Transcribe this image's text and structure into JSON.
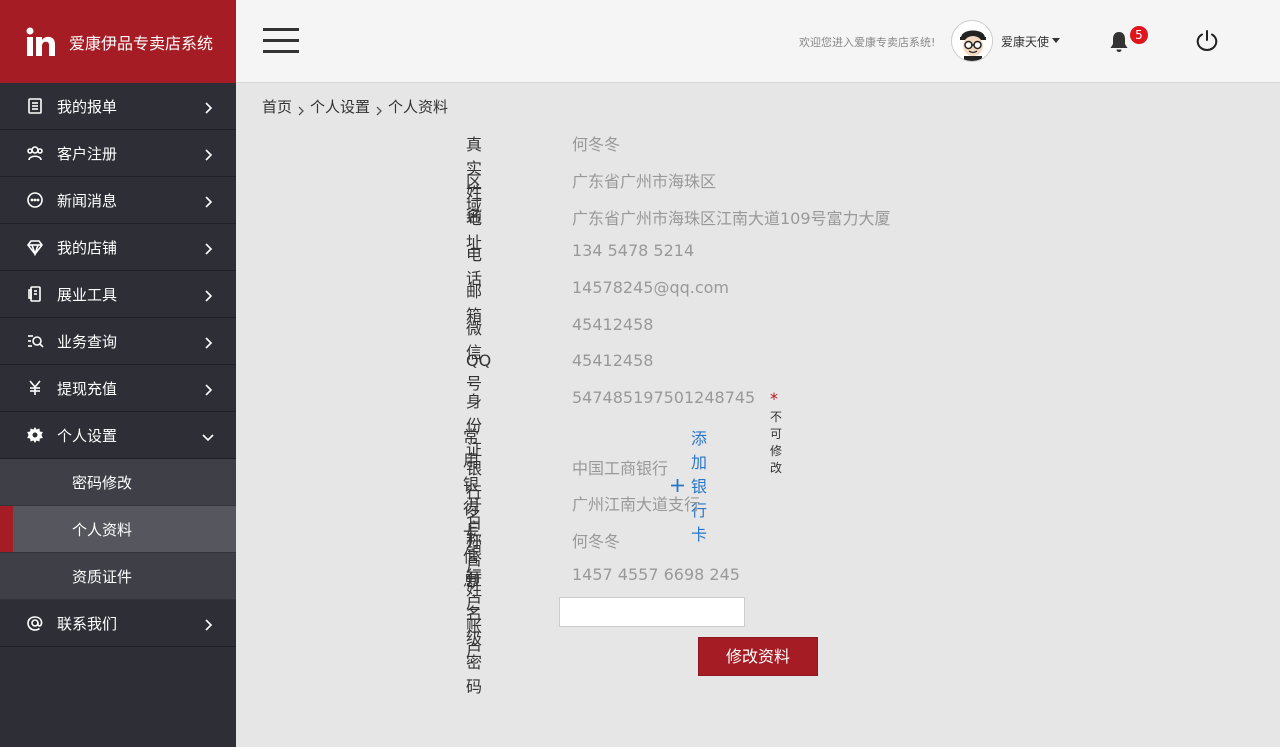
{
  "brand": {
    "name": "爱康伊品专卖店系统",
    "logo_text": "in"
  },
  "colors": {
    "brand_red": "#a61c24",
    "sidebar_bg": "#2e2f36",
    "link_blue": "#2a77c9",
    "badge_red": "#e0141d"
  },
  "sidebar": {
    "items": [
      {
        "label": "我的报单",
        "icon": "list-doc-icon"
      },
      {
        "label": "客户注册",
        "icon": "users-icon"
      },
      {
        "label": "新闻消息",
        "icon": "chat-bubble-icon"
      },
      {
        "label": "我的店铺",
        "icon": "diamond-icon"
      },
      {
        "label": "展业工具",
        "icon": "tools-icon"
      },
      {
        "label": "业务查询",
        "icon": "search-list-icon"
      },
      {
        "label": "提现充值",
        "icon": "yuan-icon"
      },
      {
        "label": "个人设置",
        "icon": "gear-icon"
      },
      {
        "label": "联系我们",
        "icon": "at-icon"
      }
    ],
    "sub_items": [
      {
        "label": "密码修改"
      },
      {
        "label": "个人资料"
      },
      {
        "label": "资质证件"
      }
    ]
  },
  "header": {
    "welcome": "欢迎您进入爱康专卖店系统!",
    "username": "爱康天使",
    "notification_count": "5"
  },
  "breadcrumb": [
    "首页",
    "个人设置",
    "个人资料"
  ],
  "profile": {
    "rows": [
      {
        "label": "真实姓名",
        "value": "何冬冬"
      },
      {
        "label": "区域",
        "value": "广东省广州市海珠区"
      },
      {
        "label": "地址",
        "value": "广东省广州市海珠区江南大道109号富力大厦"
      },
      {
        "label": "电话",
        "value": "134 5478 5214"
      },
      {
        "label": "邮箱",
        "value": "14578245@qq.com"
      },
      {
        "label": "微信",
        "value": "45412458"
      },
      {
        "label": "QQ号",
        "value": "45412458"
      },
      {
        "label": "身份证",
        "value": "547485197501248745"
      }
    ],
    "id_note": "不可修改"
  },
  "bank": {
    "section_title": "常用银行卡信息",
    "add_label": "添加银行卡",
    "rows": [
      {
        "label": "银行名称",
        "value": "中国工商银行"
      },
      {
        "label": "开户银行",
        "value": "广州江南大道支行"
      },
      {
        "label": "开户姓名",
        "value": "何冬冬"
      },
      {
        "label": "开户账户",
        "value": "1457 4557 6698 245"
      }
    ],
    "password_label": "二级密码",
    "password_value": ""
  },
  "submit_label": "修改资料"
}
